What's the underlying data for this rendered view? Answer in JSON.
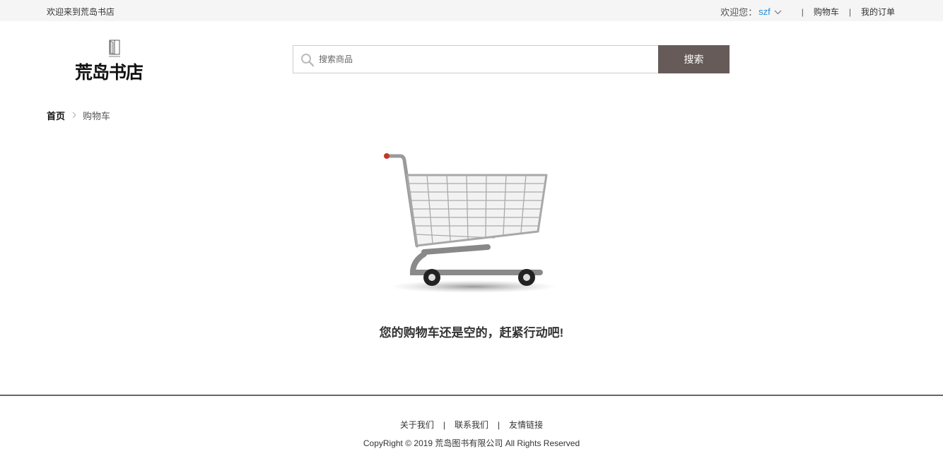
{
  "topbar": {
    "welcome": "欢迎来到荒岛书店",
    "greeting": "欢迎您：",
    "username": "szf",
    "cart_link": "购物车",
    "orders_link": "我的订单",
    "separator": "|"
  },
  "logo": {
    "text": "荒岛书店"
  },
  "search": {
    "placeholder": "搜索商品",
    "button_label": "搜索"
  },
  "breadcrumb": {
    "home": "首页",
    "current": "购物车"
  },
  "cart": {
    "empty_message": "您的购物车还是空的，赶紧行动吧!"
  },
  "footer": {
    "links": [
      "关于我们",
      "联系我们",
      "友情链接"
    ],
    "separator": "|",
    "copyright": "CopyRight © 2019 荒岛图书有限公司 All Rights Reserved"
  },
  "colors": {
    "topbar_bg": "#f5f5f5",
    "username": "#1f8fd6",
    "search_button": "#665b58",
    "footer_line": "#666666"
  }
}
